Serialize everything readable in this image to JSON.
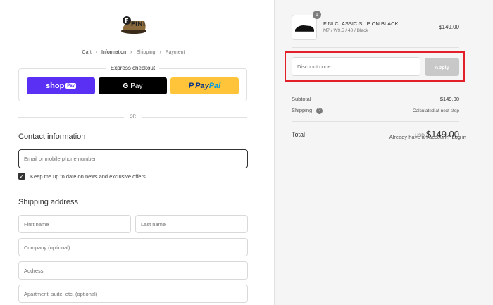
{
  "brand": {
    "logo_text": "FINI"
  },
  "breadcrumb": {
    "cart": "Cart",
    "information": "Information",
    "shipping": "Shipping",
    "payment": "Payment"
  },
  "express": {
    "title": "Express checkout",
    "shop_label": "shop",
    "shop_badge": "Pay",
    "gpay_g": "G",
    "gpay_label": "Pay",
    "paypal_pay": "Pay",
    "paypal_pal": "Pal"
  },
  "divider_or": "OR",
  "contact": {
    "title": "Contact information",
    "login_prompt": "Already have an account?",
    "login_link": "Log in",
    "email_placeholder": "Email or mobile phone number",
    "newsletter_label": "Keep me up to date on news and exclusive offers"
  },
  "shipping": {
    "title": "Shipping address",
    "first_name": "First name",
    "last_name": "Last name",
    "company": "Company (optional)",
    "address": "Address",
    "apartment": "Apartment, suite, etc. (optional)"
  },
  "order": {
    "quantity": "1",
    "product_name": "FINI CLASSIC SLIP ON BLACK",
    "variant": "M7 / W9.5 / 40 / Black",
    "price": "$149.00",
    "discount_placeholder": "Discount code",
    "apply_label": "Apply",
    "subtotal_label": "Subtotal",
    "subtotal_value": "$149.00",
    "shipping_label": "Shipping",
    "shipping_value": "Calculated at next step",
    "total_label": "Total",
    "total_currency": "USD",
    "total_value": "$149.00"
  },
  "colors": {
    "shop_pay": "#5a31f4",
    "paypal": "#ffc439",
    "highlight": "#e3202a"
  }
}
